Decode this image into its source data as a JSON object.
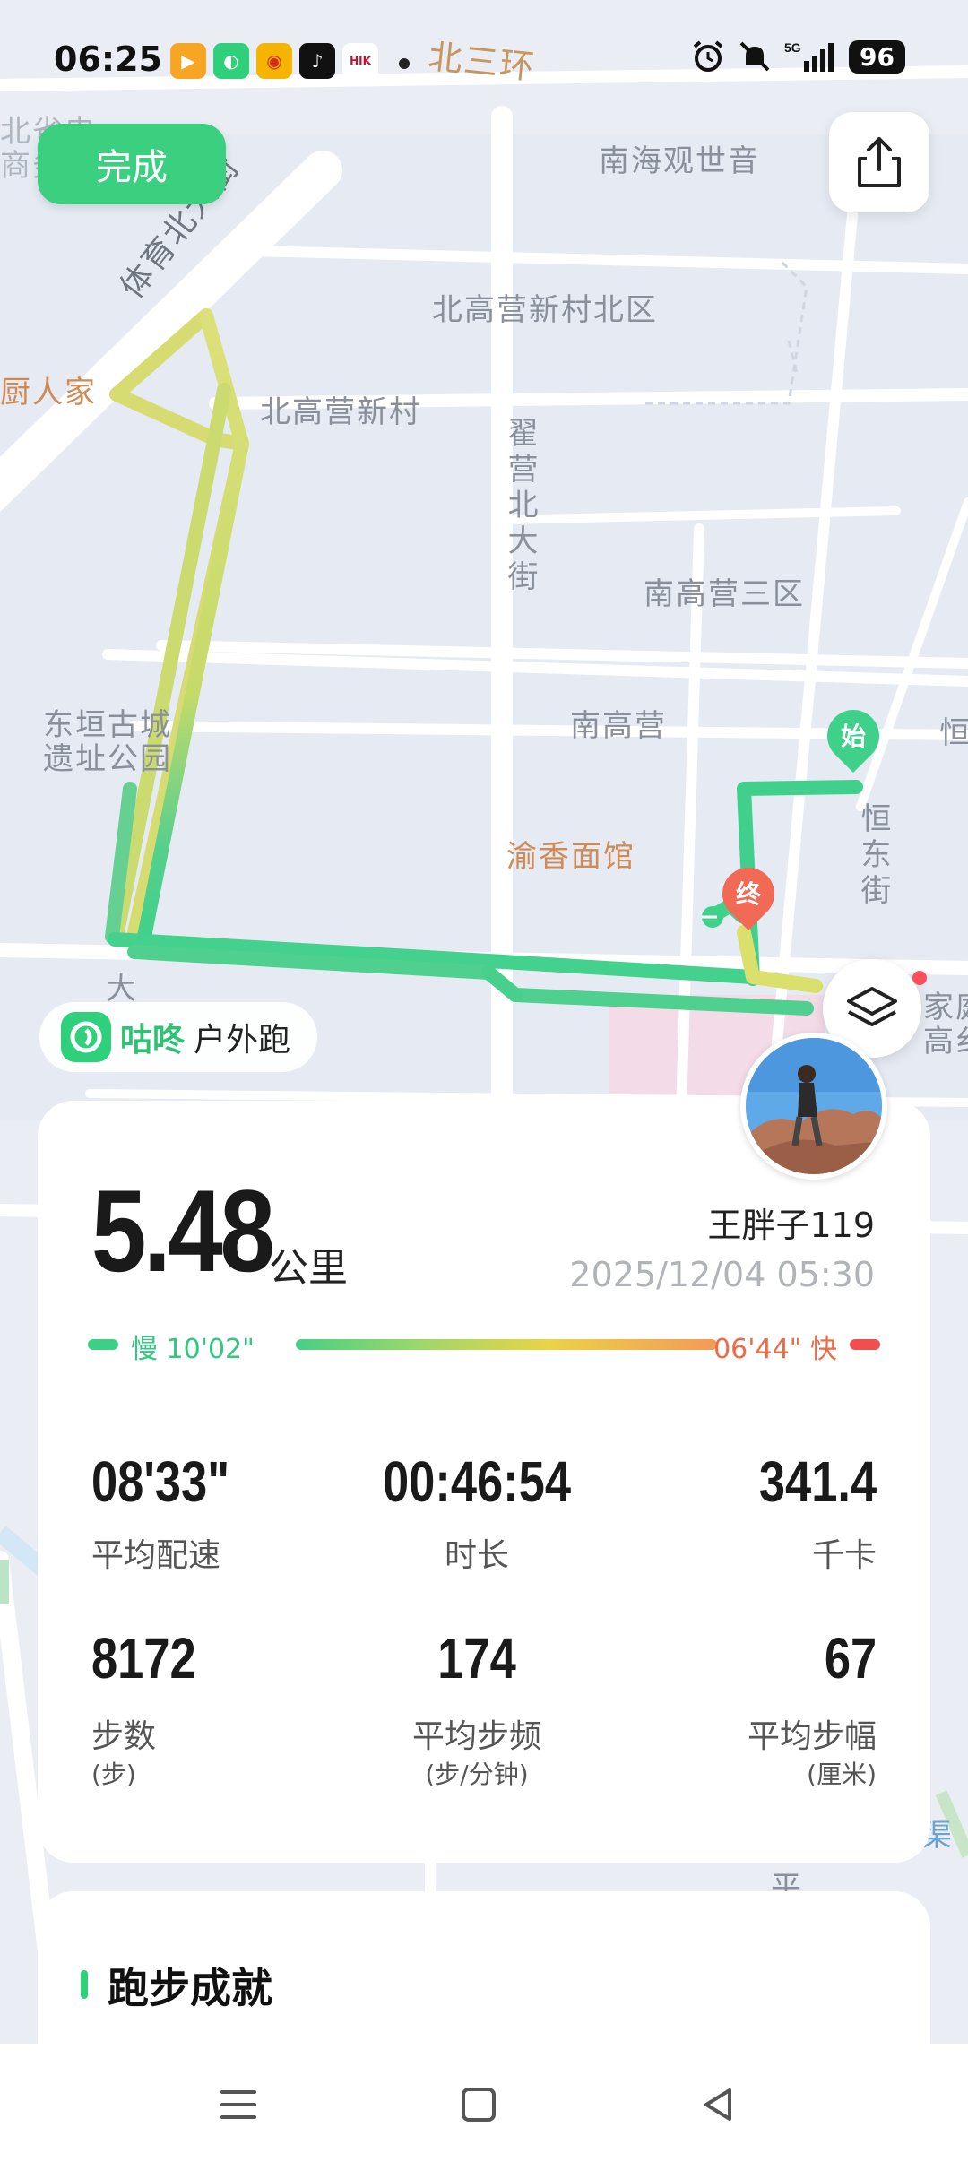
{
  "status_bar": {
    "time": "06:25",
    "battery": "96",
    "network": "5G",
    "app_icons": [
      "video-app-icon",
      "gudong-app-icon",
      "weibo-icon",
      "tiktok-icon",
      "hikvision-icon"
    ]
  },
  "map": {
    "labels": {
      "beisanhuan": "北三环",
      "nanhai": "南海观世音",
      "beigaoying_north": "北高营新村北区",
      "beigaoying": "北高营新村",
      "chuyuan": "厨人家",
      "nangaoying3": "南高营三区",
      "nangaoying": "南高营",
      "yuxiang": "渝香面馆",
      "dongyuan": "东垣古城\n遗址公园",
      "tiyu": "体育北大街",
      "zhaiying": "翟营北大街",
      "hengdong": "恒东街",
      "left_edge": "北省电\n商务",
      "da": "大",
      "heng": "恒",
      "jiating": "家庭\n高纟",
      "qu": "渠",
      "ping": "平"
    },
    "route_colors": {
      "slow": "#3fd18a",
      "mid": "#c7db6a",
      "fast": "#e5dc67"
    },
    "start_marker": "始",
    "end_marker": "终"
  },
  "toolbar": {
    "done_label": "完成",
    "share_icon": "share-icon",
    "layers_icon": "layers-icon"
  },
  "brand": {
    "name": "咕咚",
    "sub": "户外跑"
  },
  "summary": {
    "distance": "5.48",
    "distance_unit": "公里",
    "username": "王胖子119",
    "datetime": "2025/12/04 05:30",
    "pace_slow_label": "慢 10'02\"",
    "pace_fast_label": "06'44\" 快"
  },
  "stats": [
    {
      "value": "08'33\"",
      "label": "平均配速",
      "sub": ""
    },
    {
      "value": "00:46:54",
      "label": "时长",
      "sub": ""
    },
    {
      "value": "341.4",
      "label": "千卡",
      "sub": ""
    },
    {
      "value": "8172",
      "label": "步数",
      "sub": "(步)"
    },
    {
      "value": "174",
      "label": "平均步频",
      "sub": "(步/分钟)"
    },
    {
      "value": "67",
      "label": "平均步幅",
      "sub": "(厘米)"
    }
  ],
  "achievement": {
    "title": "跑步成就"
  },
  "colors": {
    "accent": "#2fd07c",
    "pace_fast": "#f06a45",
    "pace_slow": "#35c682"
  }
}
